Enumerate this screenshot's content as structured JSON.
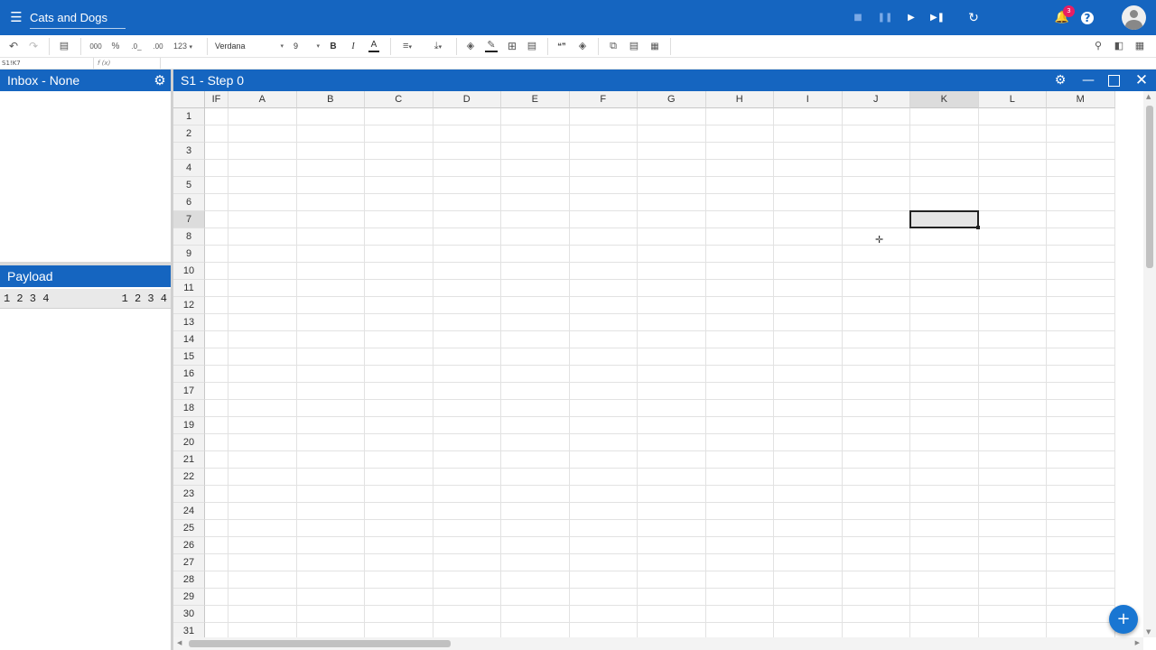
{
  "app": {
    "title": "Cats and Dogs",
    "icons": {
      "menu": "menu-icon",
      "stop": "stop-icon",
      "pause": "pause-icon",
      "play": "play-icon",
      "step": "skip-next-icon",
      "refresh": "refresh-icon",
      "bell": "bell-icon",
      "help": "help-icon",
      "account": "account-icon"
    },
    "notification_count": "3"
  },
  "toolbar": {
    "format_thousands": "000",
    "format_percent": "%",
    "decimal_decrease": ".0_",
    "decimal_increase": ".00",
    "number_format": "123",
    "font_family": "Verdana",
    "font_size": "9",
    "bold": "B",
    "italic": "I",
    "font_color": "A"
  },
  "formula_bar": {
    "cell_ref": "S1!K7",
    "fx_label": "f (x)",
    "value": ""
  },
  "inbox_panel": {
    "title": "Inbox - None"
  },
  "payload_panel": {
    "title": "Payload",
    "row_left": "1 2 3 4",
    "row_right": "1 2 3 4"
  },
  "sheet": {
    "title": "S1 - Step 0",
    "columns": [
      "IF",
      "A",
      "B",
      "C",
      "D",
      "E",
      "F",
      "G",
      "H",
      "I",
      "J",
      "K",
      "L",
      "M"
    ],
    "rows": [
      "1",
      "2",
      "3",
      "4",
      "5",
      "6",
      "7",
      "8",
      "9",
      "10",
      "11",
      "12",
      "13",
      "14",
      "15",
      "16",
      "17",
      "18",
      "19",
      "20",
      "21",
      "22",
      "23",
      "24",
      "25",
      "26",
      "27",
      "28",
      "29",
      "30",
      "31"
    ],
    "selected_column": "K",
    "selected_row": "7",
    "add_button": "+"
  },
  "colors": {
    "primary": "#1565c0",
    "badge": "#e91e63",
    "fab": "#1976d2"
  }
}
